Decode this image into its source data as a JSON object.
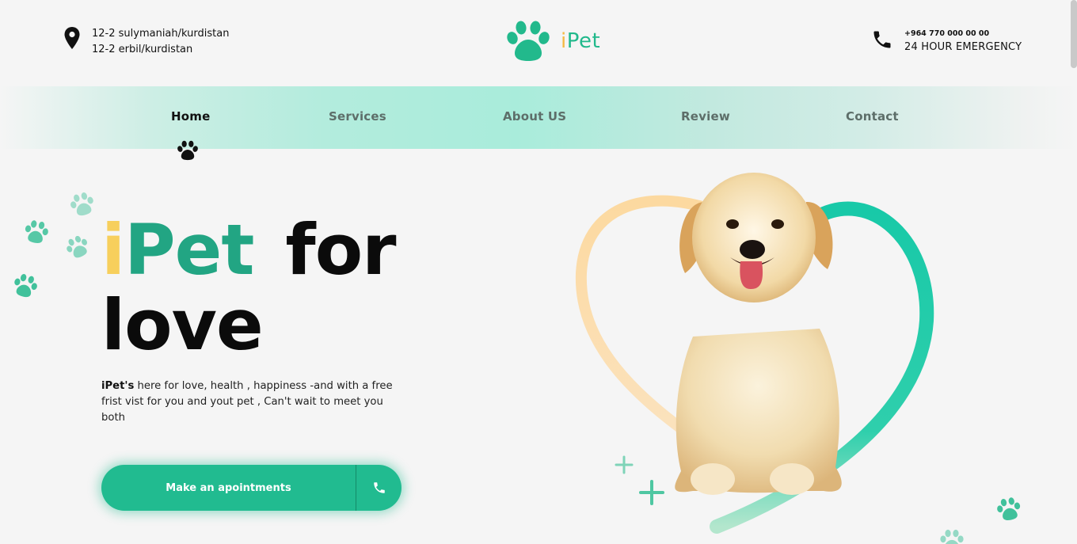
{
  "header": {
    "address_lines": [
      "12-2 sulymaniah/kurdistan",
      "12-2 erbil/kurdistan"
    ],
    "location_icon": "location-pin-icon",
    "logo": {
      "icon": "paw-icon",
      "i": "i",
      "pet": "Pet"
    },
    "phone_icon": "phone-icon",
    "emergency_number": "+964 770 000 00 00",
    "emergency_label": "24 HOUR EMERGENCY"
  },
  "nav": {
    "items": [
      {
        "label": "Home",
        "active": true
      },
      {
        "label": "Services",
        "active": false
      },
      {
        "label": "About US",
        "active": false
      },
      {
        "label": "Review",
        "active": false
      },
      {
        "label": "Contact",
        "active": false
      }
    ],
    "active_indicator_icon": "paw-icon"
  },
  "hero": {
    "title_i": "i",
    "title_pet": "Pet",
    "title_for": "for",
    "title_love": "love",
    "desc_brand": "iPet's",
    "desc_text": " here for love, health , happiness -and with a free frist vist for you and yout pet , Can't wait to meet you both",
    "cta_label": "Make an apointments",
    "cta_icon": "phone-icon",
    "image_alt": "golden retriever puppy inside heart"
  },
  "colors": {
    "brand_green": "#21bb90",
    "brand_yellow": "#f7cf5c",
    "nav_mint": "#a9ecdb",
    "heart_gradient_start": "#fcd9a0",
    "heart_gradient_end": "#18c9a8"
  }
}
